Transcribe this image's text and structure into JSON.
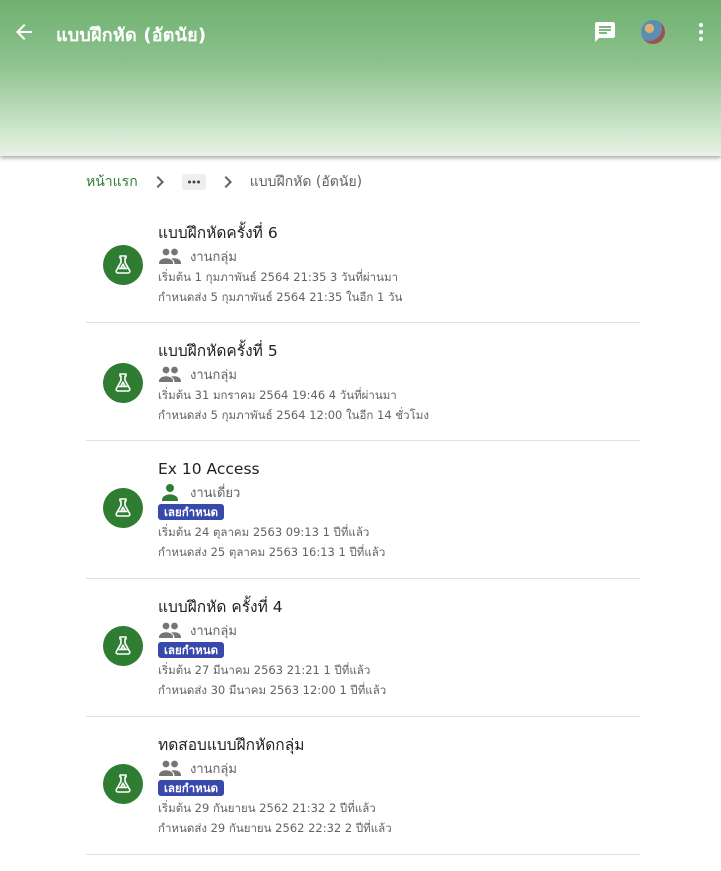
{
  "appbar": {
    "title": "แบบฝึกหัด (อัตนัย)",
    "colors": {
      "top": "#6fb071",
      "bottom": "#e8f3e6"
    },
    "icons": [
      "arrow-back-icon",
      "chat-icon",
      "avatar",
      "more-vert-icon"
    ]
  },
  "breadcrumb": {
    "home": "หน้าแรก",
    "ellipsis": "···",
    "current": "แบบฝึกหัด (อัตนัย)"
  },
  "items": [
    {
      "name": "แบบฝึกหัดครั้งที่ 6",
      "kind": "งานกลุ่ม",
      "kind_icon": "group-icon",
      "overdue": "",
      "start": "เริ่มต้น 1 กุมภาพันธ์ 2564 21:35 3 วันที่ผ่านมา",
      "due": "กำหนดส่ง 5 กุมภาพันธ์ 2564 21:35 ในอีก 1 วัน"
    },
    {
      "name": "แบบฝึกหัดครั้งที่ 5",
      "kind": "งานกลุ่ม",
      "kind_icon": "group-icon",
      "overdue": "",
      "start": "เริ่มต้น 31 มกราคม 2564 19:46 4 วันที่ผ่านมา",
      "due": "กำหนดส่ง 5 กุมภาพันธ์ 2564 12:00 ในอีก 14 ชั่วโมง"
    },
    {
      "name": "Ex 10 Access",
      "kind": "งานเดี่ยว",
      "kind_icon": "person-icon",
      "overdue": "เลยกำหนด",
      "start": "เริ่มต้น 24 ตุลาคม 2563 09:13 1 ปีที่แล้ว",
      "due": "กำหนดส่ง 25 ตุลาคม 2563 16:13 1 ปีที่แล้ว"
    },
    {
      "name": "แบบฝึกหัด ครั้งที่ 4",
      "kind": "งานกลุ่ม",
      "kind_icon": "group-icon",
      "overdue": "เลยกำหนด",
      "start": "เริ่มต้น 27 มีนาคม 2563 21:21 1 ปีที่แล้ว",
      "due": "กำหนดส่ง 30 มีนาคม 2563 12:00 1 ปีที่แล้ว"
    },
    {
      "name": "ทดสอบแบบฝึกหัดกลุ่ม",
      "kind": "งานกลุ่ม",
      "kind_icon": "group-icon",
      "overdue": "เลยกำหนด",
      "start": "เริ่มต้น 29 กันยายน 2562 21:32 2 ปีที่แล้ว",
      "due": "กำหนดส่ง 29 กันยายน 2562 22:32 2 ปีที่แล้ว"
    }
  ],
  "colors": {
    "icon_bg": "#2e7d32",
    "badge_bg": "#3949ab",
    "link": "#2e7d32"
  }
}
